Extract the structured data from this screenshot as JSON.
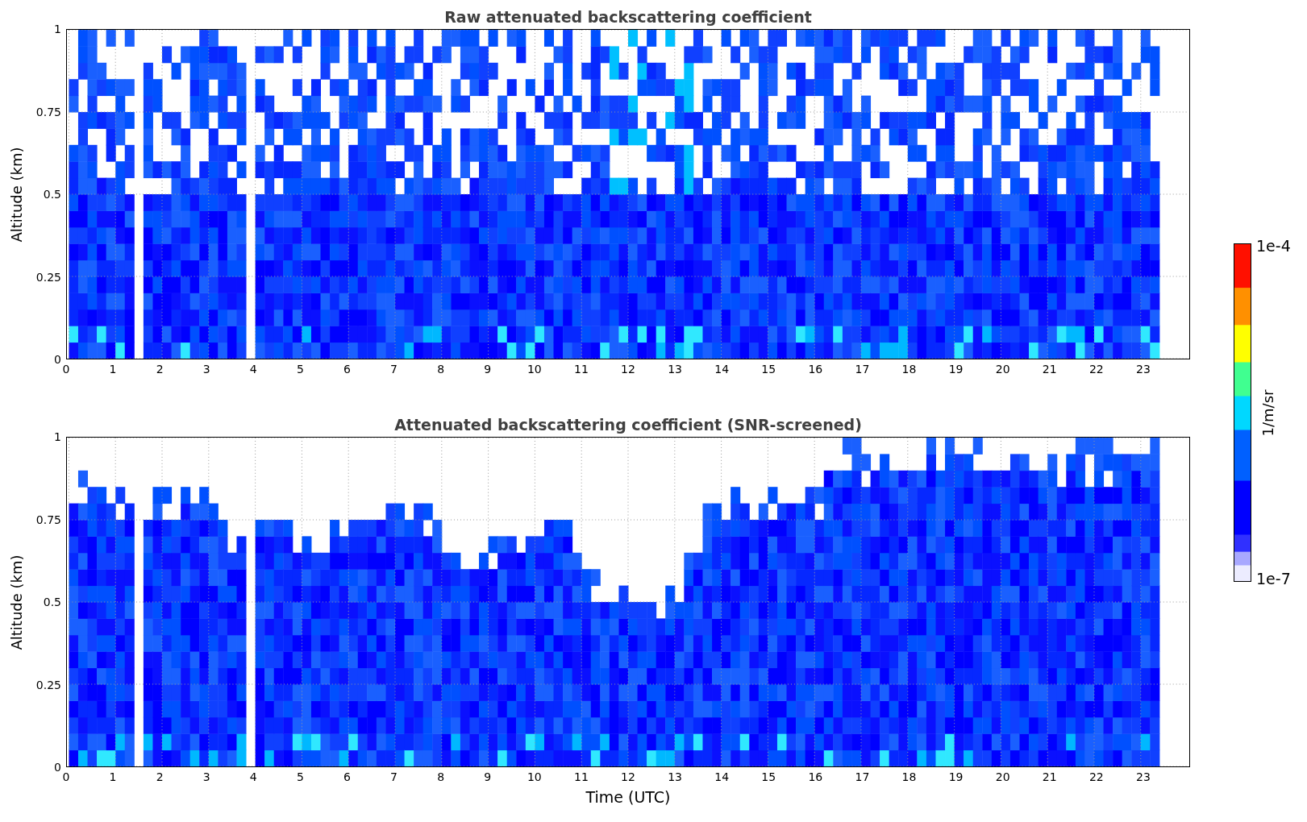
{
  "panels": [
    {
      "title": "Raw attenuated backscattering coefficient",
      "ylabel": "Altitude (km)",
      "yticks": [
        "1",
        "0.75",
        "0.5",
        "0.25",
        "0"
      ],
      "xticks": [
        "0",
        "1",
        "2",
        "3",
        "4",
        "5",
        "6",
        "7",
        "8",
        "9",
        "10",
        "11",
        "12",
        "13",
        "14",
        "15",
        "16",
        "17",
        "18",
        "19",
        "20",
        "21",
        "22",
        "23"
      ],
      "masked": false
    },
    {
      "title": "Attenuated backscattering coefficient (SNR-screened)",
      "ylabel": "Altitude (km)",
      "yticks": [
        "1",
        "0.75",
        "0.5",
        "0.25",
        "0"
      ],
      "xticks": [
        "0",
        "1",
        "2",
        "3",
        "4",
        "5",
        "6",
        "7",
        "8",
        "9",
        "10",
        "11",
        "12",
        "13",
        "14",
        "15",
        "16",
        "17",
        "18",
        "19",
        "20",
        "21",
        "22",
        "23"
      ],
      "xlabel": "Time (UTC)",
      "masked": true
    }
  ],
  "colorbar": {
    "max": "1e-4",
    "label": "1/m/sr",
    "min": "1e-7"
  }
}
